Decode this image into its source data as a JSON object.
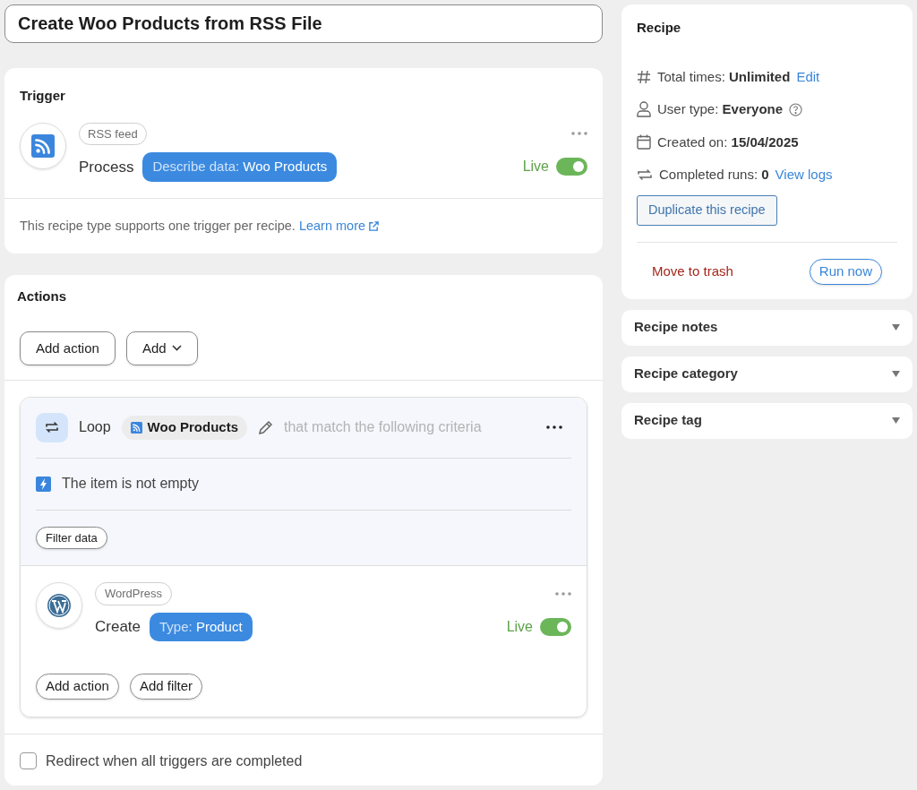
{
  "title_field": {
    "value": "Create Woo Products from RSS File"
  },
  "trigger": {
    "heading": "Trigger",
    "integration": "RSS feed",
    "verb": "Process",
    "pill": {
      "label": "Describe data:",
      "value": "Woo Products"
    },
    "status": "Live",
    "on": true,
    "note": "This recipe type supports one trigger per recipe.",
    "link": "Learn more"
  },
  "actions": {
    "heading": "Actions",
    "buttons": [
      {
        "label": "Add action",
        "kind": "plain"
      },
      {
        "label": "Add",
        "kind": "dropdown"
      }
    ],
    "loop": {
      "label": "Loop",
      "token": "Woo Products",
      "hint": "that match the following criteria",
      "condition": "The item is not empty",
      "button": "Filter data"
    },
    "action": {
      "integration": "WordPress",
      "verb": "Create",
      "pill": {
        "label": "Type:",
        "value": "Product"
      },
      "status": "Live",
      "on": true,
      "buttons": [
        "Add action",
        "Add filter"
      ]
    },
    "redirect": {
      "label": "Redirect when all triggers are completed",
      "checked": false
    }
  },
  "recipe": {
    "heading": "Recipe",
    "rows": [
      {
        "kind": "hash",
        "label": "Total times:",
        "value": "Unlimited",
        "link": "Edit"
      },
      {
        "kind": "user",
        "label": "User type:",
        "value": "Everyone",
        "help": true
      },
      {
        "kind": "calendar",
        "label": "Created on:",
        "value": "15/04/2025"
      },
      {
        "kind": "repeat",
        "label": "Completed runs:",
        "value": "0",
        "link": "View logs"
      }
    ],
    "duplicate": "Duplicate this recipe",
    "trash": "Move to trash",
    "run": "Run now"
  },
  "panels": [
    {
      "title": "Recipe notes",
      "expanded": false
    },
    {
      "title": "Recipe category",
      "expanded": false
    },
    {
      "title": "Recipe tag",
      "expanded": false
    }
  ]
}
